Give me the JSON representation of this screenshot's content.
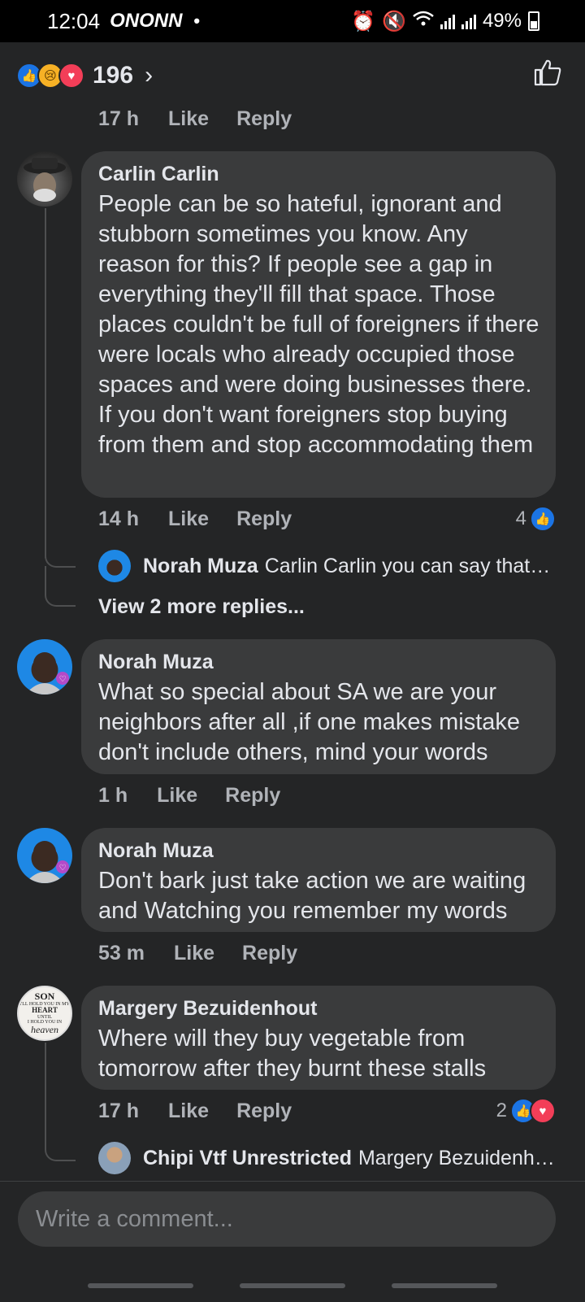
{
  "status_bar": {
    "time": "12:04",
    "app_icons": "ONONN",
    "dot": "•",
    "battery": "49%"
  },
  "reactions": {
    "count": "196",
    "chevron": "›",
    "types": [
      "like",
      "sad",
      "love"
    ]
  },
  "top_meta": {
    "time": "17 h",
    "like": "Like",
    "reply": "Reply"
  },
  "comments": [
    {
      "author": "Carlin Carlin",
      "text": "People can be so hateful, ignorant and stubborn sometimes you know. Any reason for this? If people see a gap in everything they'll fill that space. Those places couldn't be full of foreigners if there were locals who already occupied those spaces and were doing businesses there. If you don't want foreigners stop buying from them and stop accommodating them",
      "time": "14 h",
      "like": "Like",
      "reply": "Reply",
      "reaction_count": "4",
      "reply_preview": {
        "name": "Norah Muza",
        "text": "Carlin Carlin you can say that a..."
      },
      "view_more": "View 2 more replies..."
    },
    {
      "author": "Norah Muza",
      "text": "What so special about SA we are your neighbors  after all ,if one makes mistake don't include others, mind your words",
      "time": "1 h",
      "like": "Like",
      "reply": "Reply"
    },
    {
      "author": "Norah Muza",
      "text": "Don't bark just take action we are waiting and Watching you remember my words",
      "time": "53 m",
      "like": "Like",
      "reply": "Reply"
    },
    {
      "author": "Margery Bezuidenhout",
      "text": "Where will they buy vegetable from tomorrow after they burnt these stalls",
      "time": "17 h",
      "like": "Like",
      "reply": "Reply",
      "reaction_count": "2",
      "reply_preview": {
        "name": "Chipi Vtf Unrestricted",
        "text": "Margery Bezuidenho..."
      }
    }
  ],
  "margery_avatar_text": [
    "SON",
    "I'LL HOLD YOU IN MY",
    "HEART",
    "UNTIL",
    "I HOLD YOU IN",
    "heaven"
  ],
  "composer": {
    "placeholder": "Write a comment..."
  },
  "colors": {
    "background": "#242526",
    "bubble": "#3a3b3c",
    "like_blue": "#1b74e4",
    "love_red": "#f33e58"
  }
}
